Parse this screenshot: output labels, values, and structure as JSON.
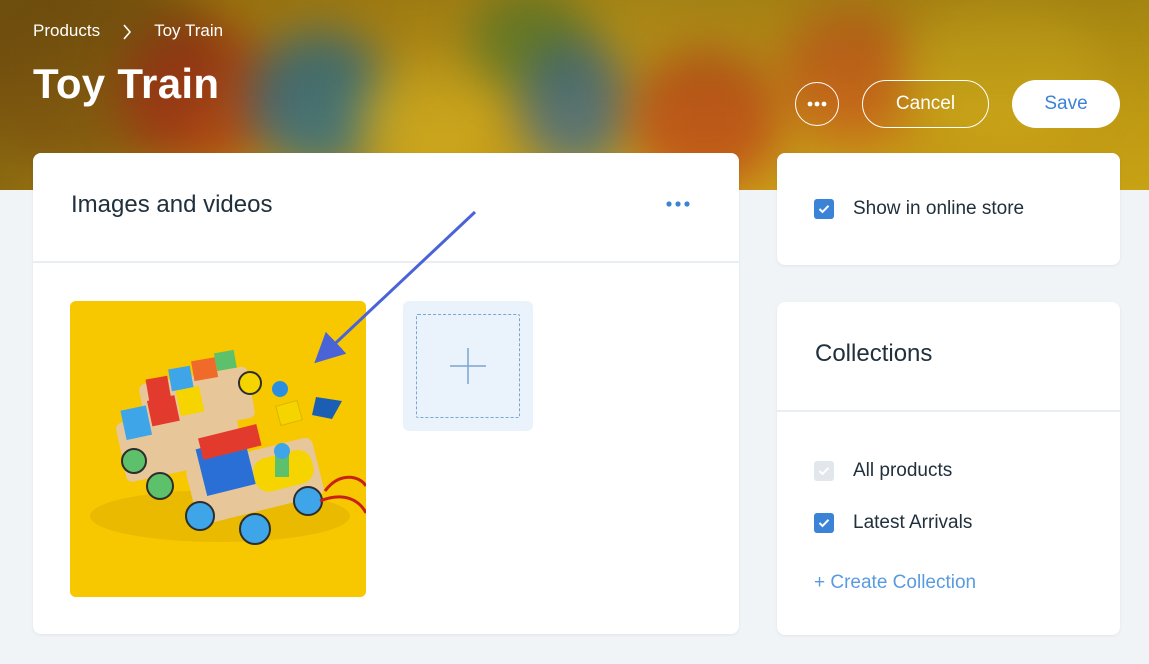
{
  "breadcrumb": {
    "parent": "Products",
    "current": "Toy Train"
  },
  "page": {
    "title": "Toy Train"
  },
  "actions": {
    "cancel_label": "Cancel",
    "save_label": "Save"
  },
  "media": {
    "title": "Images and videos",
    "image_alt": "Toy train product photo"
  },
  "store": {
    "show_label": "Show in online store",
    "show_checked": true
  },
  "collections": {
    "title": "Collections",
    "items": [
      {
        "label": "All products",
        "checked": true,
        "disabled": true
      },
      {
        "label": "Latest Arrivals",
        "checked": true,
        "disabled": false
      }
    ],
    "create_label": "+ Create Collection"
  },
  "colors": {
    "accent": "#3b83d6",
    "link": "#5a9be0",
    "image_bg": "#f7c800"
  }
}
